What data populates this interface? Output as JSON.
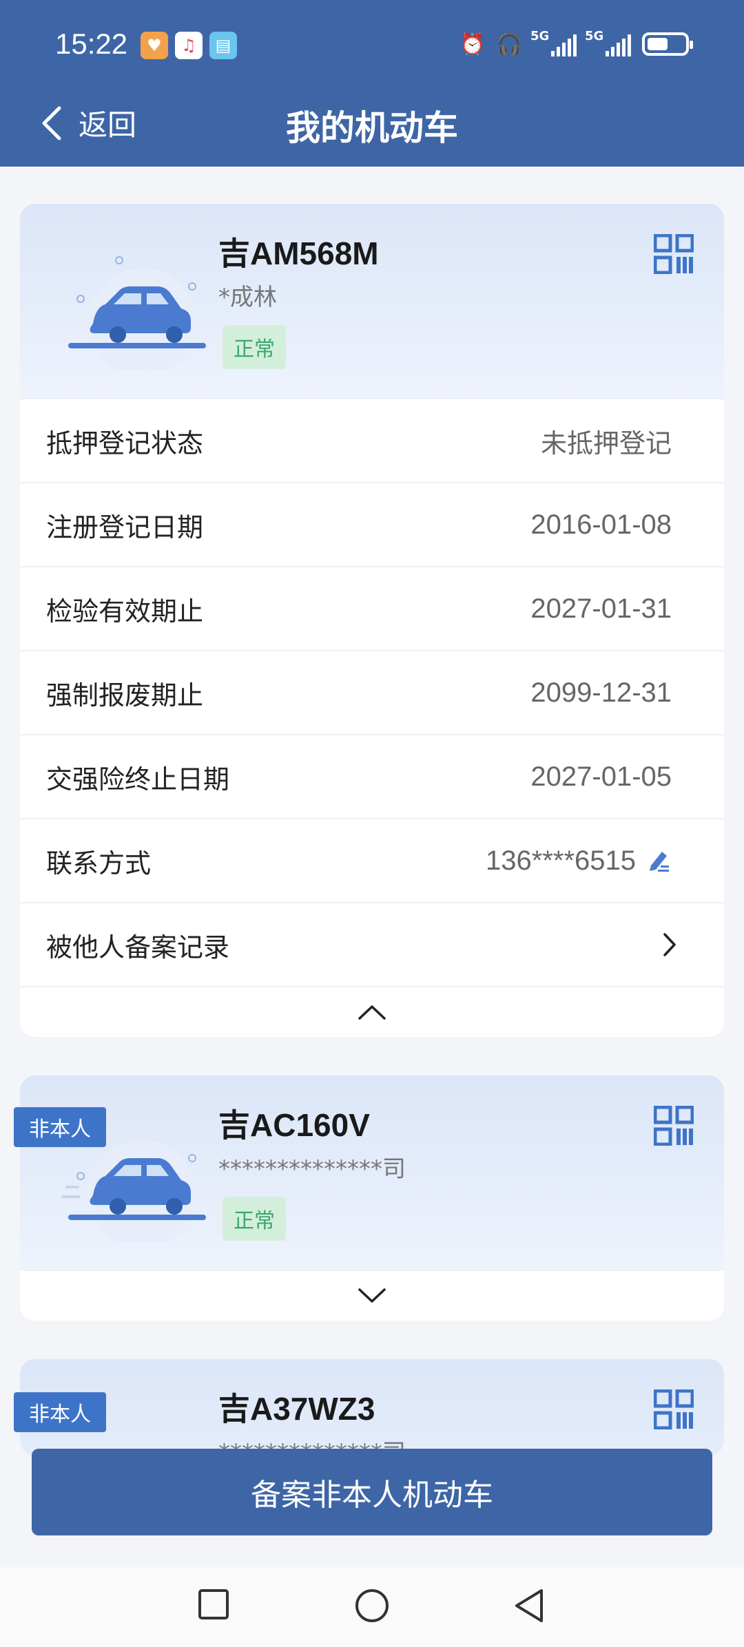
{
  "status_bar": {
    "time": "15:22",
    "signal_labels": [
      "5G",
      "5G"
    ],
    "battery_level": 0.55
  },
  "nav": {
    "back_label": "返回",
    "title": "我的机动车"
  },
  "vehicles": [
    {
      "plate": "吉AM568M",
      "owner": "*成林",
      "status": "正常",
      "non_self_label": "",
      "details": [
        {
          "label": "抵押登记状态",
          "value": "未抵押登记"
        },
        {
          "label": "注册登记日期",
          "value": "2016-01-08"
        },
        {
          "label": "检验有效期止",
          "value": "2027-01-31"
        },
        {
          "label": "强制报废期止",
          "value": "2099-12-31"
        },
        {
          "label": "交强险终止日期",
          "value": "2027-01-05"
        },
        {
          "label": "联系方式",
          "value": "136****6515"
        },
        {
          "label": "被他人备案记录",
          "value": ""
        }
      ]
    },
    {
      "plate": "吉AC160V",
      "owner": "**************司",
      "status": "正常",
      "non_self_label": "非本人"
    },
    {
      "plate": "吉A37WZ3",
      "owner": "**************司",
      "non_self_label": "非本人"
    }
  ],
  "bottom_button": "备案非本人机动车",
  "icons": {
    "back": "chevron-left-icon",
    "qr": "qr-code-icon",
    "edit": "edit-icon",
    "collapse": "chevron-up-icon",
    "expand": "chevron-down-icon",
    "arrow": "chevron-right-icon"
  },
  "colors": {
    "header": "#3e66a6",
    "badge_bg": "#d3efdc",
    "badge_text": "#3aa86a",
    "non_self_bg": "#3e74c8"
  }
}
